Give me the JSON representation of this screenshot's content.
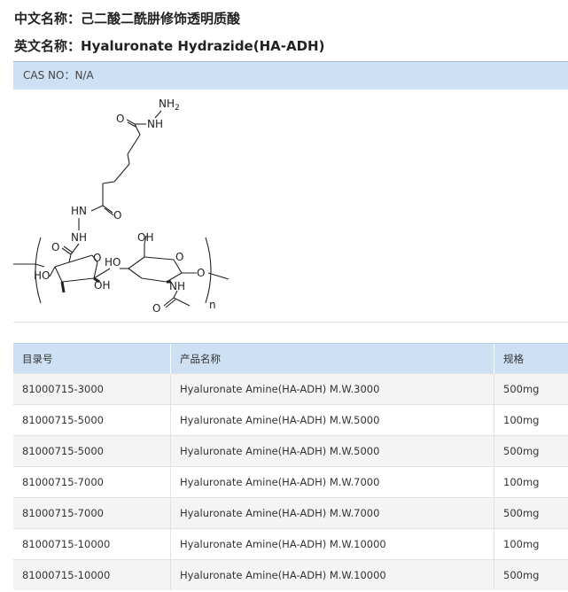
{
  "product": {
    "chinese_name_label": "中文名称：",
    "chinese_name": "己二酸二酰肼修饰透明质酸",
    "english_name_label": "英文名称：",
    "english_name": "Hyaluronate Hydrazide(HA-ADH)",
    "cas_label": "CAS NO：",
    "cas_value": "N/A"
  },
  "structure_labels": {
    "nh2": "NH",
    "nh2_sub": "2",
    "nh_top": "NH",
    "o_top": "O",
    "hnn": "HN",
    "o_mid": "O",
    "nh_mid": "NH",
    "o_ring1_carbonyl": "O",
    "o_ring1": "O",
    "ho_left": "HO",
    "oh_ring1": "OH",
    "ho_ring2": "HO",
    "oh_ring2_top": "OH",
    "o_ring2": "O",
    "nh_ring2": "NH",
    "o_acetyl": "O",
    "o_link": "O",
    "n_sub": "n"
  },
  "table": {
    "headers": [
      "目录号",
      "产品名称",
      "规格"
    ],
    "rows": [
      [
        "81000715-3000",
        "Hyaluronate Amine(HA-ADH) M.W.3000",
        "500mg"
      ],
      [
        "81000715-5000",
        "Hyaluronate Amine(HA-ADH) M.W.5000",
        "100mg"
      ],
      [
        "81000715-5000",
        "Hyaluronate Amine(HA-ADH) M.W.5000",
        "500mg"
      ],
      [
        "81000715-7000",
        "Hyaluronate Amine(HA-ADH) M.W.7000",
        "100mg"
      ],
      [
        "81000715-7000",
        "Hyaluronate Amine(HA-ADH) M.W.7000",
        "500mg"
      ],
      [
        "81000715-10000",
        "Hyaluronate Amine(HA-ADH) M.W.10000",
        "100mg"
      ],
      [
        "81000715-10000",
        "Hyaluronate Amine(HA-ADH) M.W.10000",
        "500mg"
      ]
    ]
  }
}
